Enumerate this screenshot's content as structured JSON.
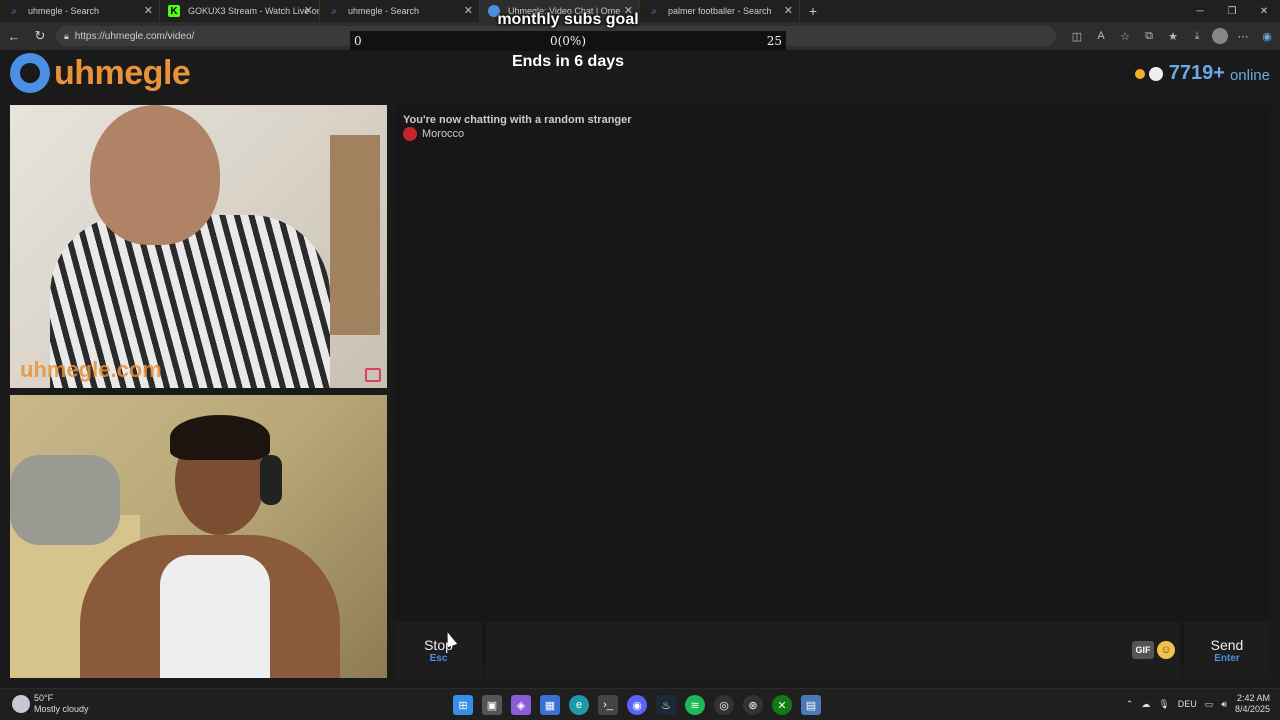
{
  "browser": {
    "tabs": [
      {
        "title": "uhmegle - Search",
        "icon": "search-icon",
        "active": false
      },
      {
        "title": "GOKUX3 Stream - Watch Live on",
        "icon": "kick-icon",
        "active": false
      },
      {
        "title": "uhmegle - Search",
        "icon": "search-icon",
        "active": false
      },
      {
        "title": "Uhmegle: Video Chat | Ome",
        "icon": "uhmegle-icon",
        "active": true
      },
      {
        "title": "palmer footballer - Search",
        "icon": "search-icon",
        "active": false
      }
    ],
    "url": "https://uhmegle.com/video/"
  },
  "overlay": {
    "goal_title": "monthly subs goal",
    "goal_start": "0",
    "goal_progress": "0(0%)",
    "goal_end": "25",
    "goal_fraction": 0,
    "ends_in": "Ends in 6 days"
  },
  "site": {
    "logo_text": "uhmegle",
    "online_count": "7719+",
    "online_label": "online",
    "watermark": "uhmegle.com"
  },
  "chat": {
    "status": "You're now chatting with a random stranger",
    "country": "Morocco"
  },
  "controls": {
    "stop_label": "Stop",
    "stop_key": "Esc",
    "gif_label": "GIF",
    "send_label": "Send",
    "send_key": "Enter"
  },
  "taskbar": {
    "temperature": "50°F",
    "weather": "Mostly cloudy",
    "language": "DEU",
    "time": "2:42 AM",
    "date": "8/4/2025"
  },
  "colors": {
    "accent": "#4a90e2",
    "logo_orange": "#e8923a",
    "online_blue": "#6aa8e6"
  }
}
